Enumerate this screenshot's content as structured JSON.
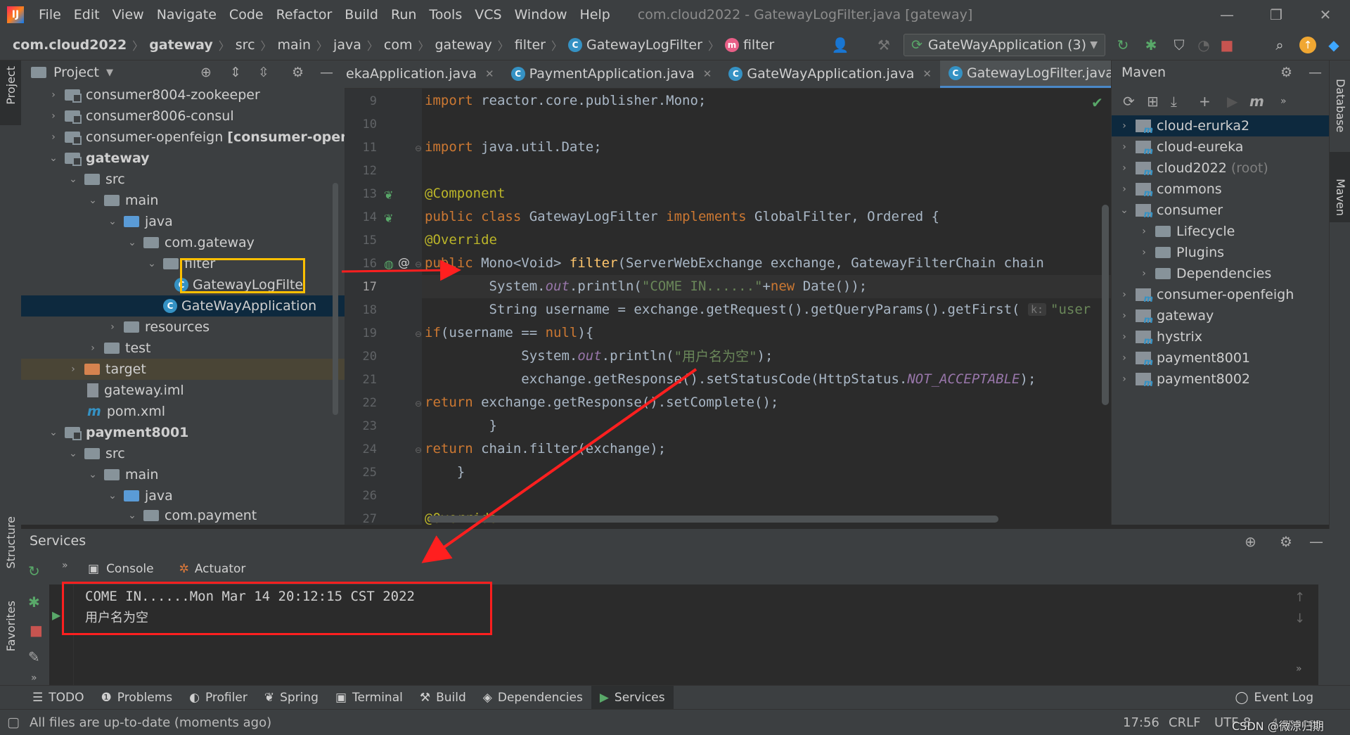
{
  "menu": {
    "items": [
      "File",
      "Edit",
      "View",
      "Navigate",
      "Code",
      "Refactor",
      "Build",
      "Run",
      "Tools",
      "VCS",
      "Window",
      "Help"
    ],
    "window_title": "com.cloud2022 - GatewayLogFilter.java [gateway]"
  },
  "breadcrumb": [
    "com.cloud2022",
    "gateway",
    "src",
    "main",
    "java",
    "com",
    "gateway",
    "filter",
    "GatewayLogFilter",
    "filter"
  ],
  "run_config": "GateWayApplication (3)",
  "project_panel": {
    "title": "Project",
    "rows": [
      {
        "label": "consumer8004-zookeeper",
        "bold": false
      },
      {
        "label": "consumer8006-consul",
        "bold": false
      },
      {
        "label": "consumer-openfeign",
        "suffix": "[consumer-openfei",
        "bold": false
      },
      {
        "label": "gateway",
        "bold": true
      },
      {
        "label": "src"
      },
      {
        "label": "main"
      },
      {
        "label": "java"
      },
      {
        "label": "com.gateway"
      },
      {
        "label": "filter"
      },
      {
        "label": "GatewayLogFilte"
      },
      {
        "label": "GateWayApplication"
      },
      {
        "label": "resources"
      },
      {
        "label": "test"
      },
      {
        "label": "target"
      },
      {
        "label": "gateway.iml"
      },
      {
        "label": "pom.xml"
      },
      {
        "label": "payment8001",
        "bold": true
      },
      {
        "label": "src"
      },
      {
        "label": "main"
      },
      {
        "label": "java"
      },
      {
        "label": "com.payment"
      }
    ]
  },
  "editor": {
    "tabs": [
      "ekaApplication.java",
      "PaymentApplication.java",
      "GateWayApplication.java",
      "GatewayLogFilter.java"
    ],
    "line_numbers": [
      "9",
      "10",
      "11",
      "12",
      "13",
      "14",
      "15",
      "16",
      "17",
      "18",
      "19",
      "20",
      "21",
      "22",
      "23",
      "24",
      "25",
      "26",
      "27"
    ],
    "hint_k": "k:",
    "hint_user": "\"user"
  },
  "maven": {
    "title": "Maven",
    "rows": [
      "cloud-erurka2",
      "cloud-eureka",
      "cloud2022",
      "commons",
      "consumer",
      "Lifecycle",
      "Plugins",
      "Dependencies",
      "consumer-openfeigh",
      "gateway",
      "hystrix",
      "payment8001",
      "payment8002"
    ],
    "root_label": "(root)"
  },
  "services": {
    "title": "Services",
    "tabs": [
      "Console",
      "Actuator"
    ],
    "output": [
      "COME IN......Mon Mar 14 20:12:15 CST 2022",
      "用户名为空"
    ]
  },
  "bottom_tabs": [
    "TODO",
    "Problems",
    "Profiler",
    "Spring",
    "Terminal",
    "Build",
    "Dependencies",
    "Services"
  ],
  "event_log": "Event Log",
  "status": {
    "message": "All files are up-to-date (moments ago)",
    "position": "17:56",
    "line_sep": "CRLF",
    "encoding": "UTF-8",
    "indent": "4 spaces"
  },
  "watermark": "CSDN @微凉归期",
  "side_labels": {
    "project": "Project",
    "structure": "Structure",
    "favorites": "Favorites",
    "database": "Database",
    "maven": "Maven"
  },
  "colors": {
    "accent": "#4a88c7",
    "highlight_yellow": "#ffc000",
    "annotation_red": "#ff1f1f"
  }
}
